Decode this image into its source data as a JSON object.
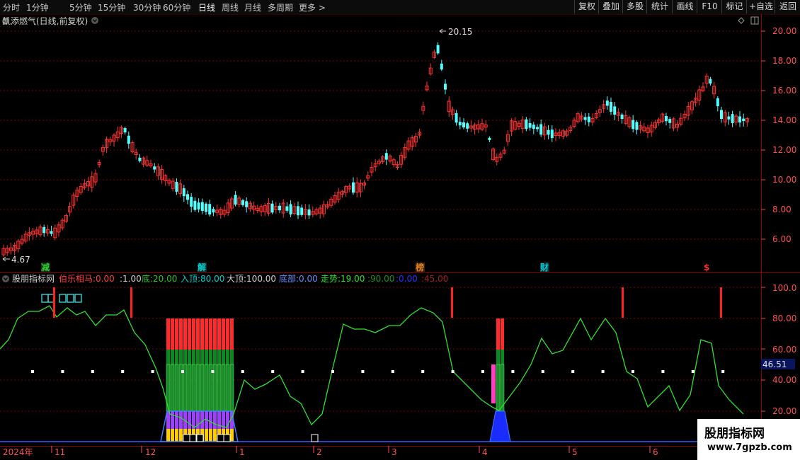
{
  "toolbar": {
    "periods": [
      "分时",
      "1分钟",
      "5分钟",
      "15分钟",
      "30分钟",
      "60分钟",
      "日线",
      "周线",
      "月线",
      "多周期",
      "更多 >"
    ],
    "active_period": "日线",
    "right_buttons": [
      "复权",
      "叠加",
      "多股",
      "统计",
      "画线",
      "F10",
      "标记",
      "+自选",
      "返回"
    ]
  },
  "main_chart": {
    "title": "凯添燃气(日线,前复权)",
    "high_label": "20.15",
    "low_label": "4.67",
    "yaxis": [
      "20.00",
      "18.00",
      "16.00",
      "14.00",
      "12.00",
      "10.00",
      "8.00",
      "6.00"
    ],
    "event_markers": [
      {
        "text": "减",
        "color": "#33cc33"
      },
      {
        "text": "解",
        "color": "#00cccc"
      },
      {
        "text": "榜",
        "color": "#e08020"
      },
      {
        "text": "财",
        "color": "#00cccc"
      },
      {
        "text": "$",
        "color": "#ff3030"
      }
    ]
  },
  "indicator": {
    "name": "股朋指标网",
    "params": [
      {
        "label": "伯乐相马:",
        "value": "0.00",
        "color": "#ff4040"
      },
      {
        "label": ":",
        "value": "1.00",
        "color": "#d0d0d0"
      },
      {
        "label": "底:",
        "value": "20.00",
        "color": "#30c030"
      },
      {
        "label": "入顶:",
        "value": "80.00",
        "color": "#00d0d0"
      },
      {
        "label": "大顶:",
        "value": "100.00",
        "color": "#d0d0d0"
      },
      {
        "label": "底部:",
        "value": "0.00",
        "color": "#6a8cff"
      },
      {
        "label": "走势:",
        "value": "19.00",
        "color": "#30e030"
      },
      {
        "label": ":",
        "value": "90.00",
        "color": "#209020"
      },
      {
        "label": ":",
        "value": "0.00",
        "color": "#3030ff"
      },
      {
        "label": ":",
        "value": "45.00",
        "color": "#a02020"
      }
    ],
    "yaxis": [
      "100.0",
      "80.00",
      "60.00",
      "40.00",
      "20.00"
    ],
    "current_value": "46.51"
  },
  "time_axis": {
    "labels": [
      "2024年",
      "11",
      "12",
      "1",
      "2",
      "3",
      "4",
      "5",
      "6"
    ]
  },
  "watermark": {
    "line1": "股朋指标网",
    "line2": "www.7gpzb.com"
  },
  "colors": {
    "up": "#ff3232",
    "down": "#54ffff",
    "grid": "#7a0000",
    "axis": "#ff4040",
    "trend": "#30e030"
  }
}
